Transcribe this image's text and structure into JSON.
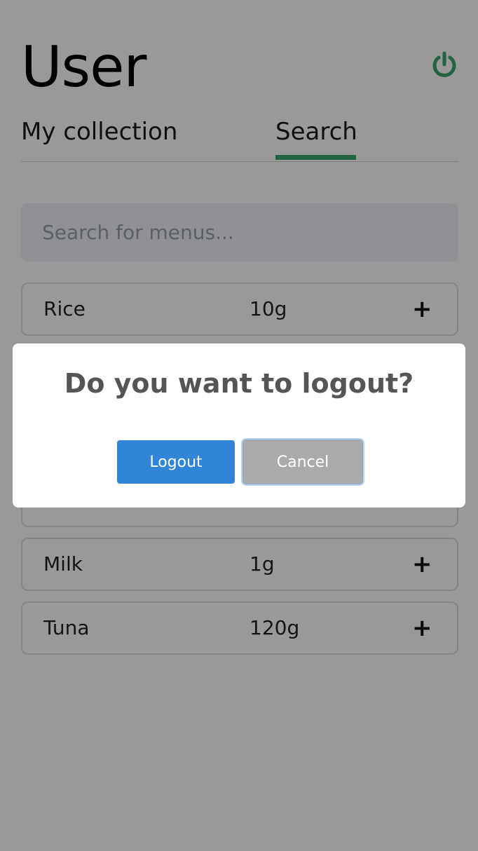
{
  "header": {
    "title": "User",
    "logout_icon": "power-icon",
    "accent_color": "#3ca66d"
  },
  "tabs": [
    {
      "label": "My collection",
      "active": false
    },
    {
      "label": "Search",
      "active": true
    }
  ],
  "search": {
    "placeholder": "Search for menus...",
    "value": ""
  },
  "items": [
    {
      "name": "Rice",
      "qty": "10g",
      "action": "+"
    },
    {
      "name": "",
      "qty": "",
      "action": ""
    },
    {
      "name": "",
      "qty": "",
      "action": ""
    },
    {
      "name": "Milk",
      "qty": "1g",
      "action": "+"
    },
    {
      "name": "Tuna",
      "qty": "120g",
      "action": "+"
    }
  ],
  "dialog": {
    "title": "Do you want to logout?",
    "confirm_label": "Logout",
    "cancel_label": "Cancel",
    "confirm_color": "#3085d6",
    "cancel_color": "#aaaaaa"
  }
}
